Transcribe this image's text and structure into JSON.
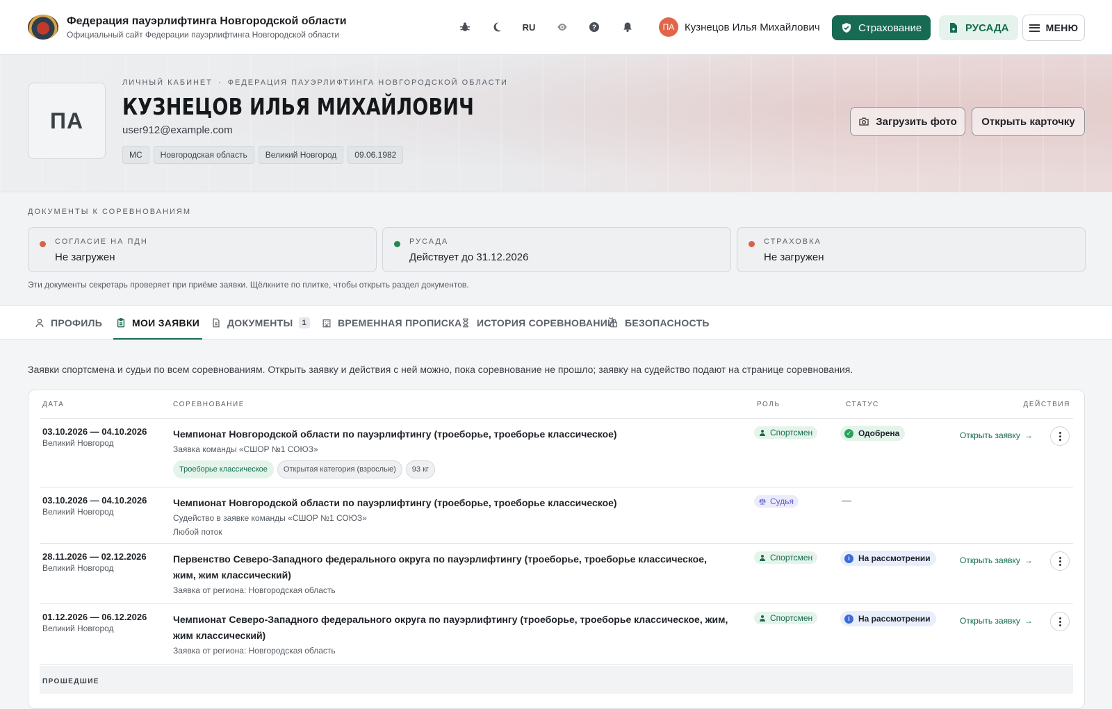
{
  "header": {
    "brand_title": "Федерация пауэрлифтинга Новгородской области",
    "brand_subtitle": "Официальный сайт Федерации пауэрлифтинга Новгородской области",
    "lang": "RU",
    "user_initials": "ПА",
    "user_name": "Кузнецов Илья Михайлович",
    "insurance_label": "Страхование",
    "rusada_label": "РУСАДА",
    "menu_label": "МЕНЮ"
  },
  "profile": {
    "avatar_initials": "ПА",
    "crumb_1": "ЛИЧНЫЙ КАБИНЕТ",
    "crumb_sep": "·",
    "crumb_2": "ФЕДЕРАЦИЯ ПАУЭРЛИФТИНГА НОВГОРОДСКОЙ ОБЛАСТИ",
    "name": "КУЗНЕЦОВ ИЛЬЯ МИХАЙЛОВИЧ",
    "email": "user912@example.com",
    "chips": [
      "МС",
      "Новгородская область",
      "Великий Новгород",
      "09.06.1982"
    ],
    "upload_label": "Загрузить фото",
    "open_card_label": "Открыть карточку"
  },
  "documents": {
    "title": "ДОКУМЕНТЫ К СОРЕВНОВАНИЯМ",
    "items": [
      {
        "label": "СОГЛАСИЕ НА ПДН",
        "value": "Не загружен",
        "color": "#d9614a"
      },
      {
        "label": "РУСАДА",
        "value": "Действует до 31.12.2026",
        "color": "#1f8a4c"
      },
      {
        "label": "СТРАХОВКА",
        "value": "Не загружен",
        "color": "#d9614a"
      }
    ],
    "hint": "Эти документы секретарь проверяет при приёме заявки. Щёлкните по плитке, чтобы открыть раздел документов."
  },
  "tabs": [
    {
      "label": "Профиль"
    },
    {
      "label": "Мои заявки",
      "active": true
    },
    {
      "label": "Документы",
      "count": "1"
    },
    {
      "label": "Временная прописка"
    },
    {
      "label": "История соревнований"
    },
    {
      "label": "Безопасность"
    }
  ],
  "intro": "Заявки спортсмена и судьи по всем соревнованиям. Открыть заявку и действия с ней можно, пока соревнование не прошло; заявку на судейство подают на странице соревнования.",
  "table": {
    "columns": {
      "date": "ДАТА",
      "competition": "СОРЕВНОВАНИЕ",
      "role": "РОЛЬ",
      "status": "СТАТУС",
      "actions": "ДЕЙСТВИЯ"
    },
    "rows": [
      {
        "date": "03.10.2026 — 04.10.2026",
        "city": "Великий Новгород",
        "title": "Чемпионат Новгородской области по пауэрлифтингу (троеборье, троеборье классическое)",
        "sub": "Заявка команды «СШОР №1 СОЮЗ»",
        "tags": [
          "Троеборье классическое",
          "Открытая категория (взрослые)",
          "93 кг"
        ],
        "role": "Спортсмен",
        "status": "Одобрена",
        "action": "Открыть заявку"
      },
      {
        "date": "03.10.2026 — 04.10.2026",
        "city": "Великий Новгород",
        "title": "Чемпионат Новгородской области по пауэрлифтингу (троеборье, троеборье классическое)",
        "sub": "Судейство в заявке команды «СШОР №1 СОЮЗ»",
        "sub2": "Любой поток",
        "role": "Судья",
        "status": "—"
      },
      {
        "date": "28.11.2026 — 02.12.2026",
        "city": "Великий Новгород",
        "title": "Первенство Северо-Западного федерального округа по пауэрлифтингу (троеборье, троеборье классическое, жим, жим классический)",
        "sub": "Заявка от региона: Новгородская область",
        "role": "Спортсмен",
        "status": "На рассмотрении",
        "action": "Открыть заявку"
      },
      {
        "date": "01.12.2026 — 06.12.2026",
        "city": "Великий Новгород",
        "title": "Чемпионат Северо-Западного федерального округа по пауэрлифтингу (троеборье, троеборье классическое, жим, жим классический)",
        "sub": "Заявка от региона: Новгородская область",
        "role": "Спортсмен",
        "status": "На рассмотрении",
        "action": "Открыть заявку"
      }
    ],
    "past_label": "ПРОШЕДШИЕ"
  },
  "colors": {
    "accent": "#176b52",
    "accent_light": "#e6f3ec",
    "judge": "#5b5ec9",
    "pending": "#3b6bd6"
  }
}
